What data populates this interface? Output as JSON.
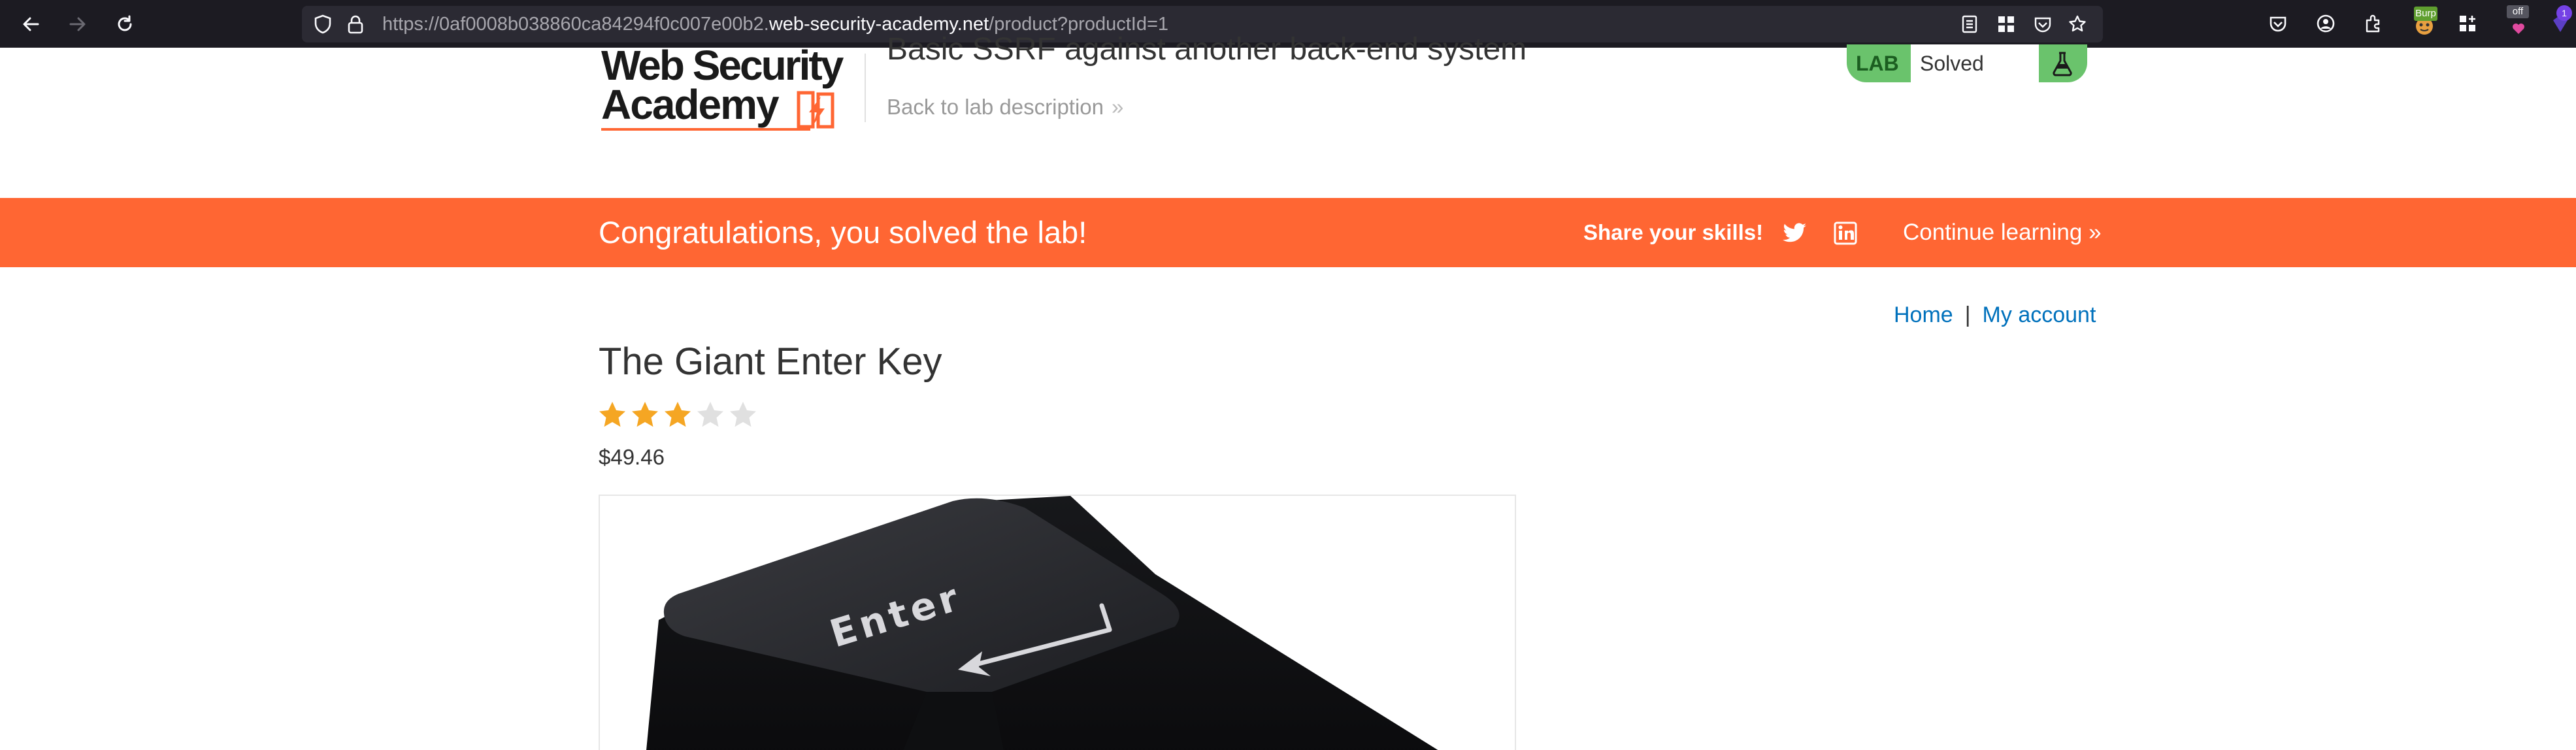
{
  "browser": {
    "url_prefix": "https://0af0008b038860ca84294f0c007e00b2.",
    "url_domain": "web-security-academy.net",
    "url_path": "/product?productId=1",
    "extension_burp_label": "Burp",
    "extension_off_label": "off",
    "extension_count": "1"
  },
  "header": {
    "logo_line1": "Web Security",
    "logo_line2": "Academy",
    "lab_title": "Basic SSRF against another back-end system",
    "back_link": "Back to lab description",
    "back_chevron": "»",
    "lab_badge": "LAB",
    "lab_status": "Solved"
  },
  "banner": {
    "message": "Congratulations, you solved the lab!",
    "share_label": "Share your skills!",
    "continue_label": "Continue learning",
    "continue_chevron": "»"
  },
  "nav": {
    "home": "Home",
    "separator": "|",
    "account": "My account"
  },
  "product": {
    "name": "The Giant Enter Key",
    "rating": 3,
    "rating_max": 5,
    "price": "$49.46",
    "image_key_text": "Enter"
  },
  "colors": {
    "accent": "#ff6633",
    "link": "#0071bc",
    "lab_green": "#6ac36c",
    "star_filled": "#f5a623",
    "star_empty": "#e0e0e0"
  }
}
